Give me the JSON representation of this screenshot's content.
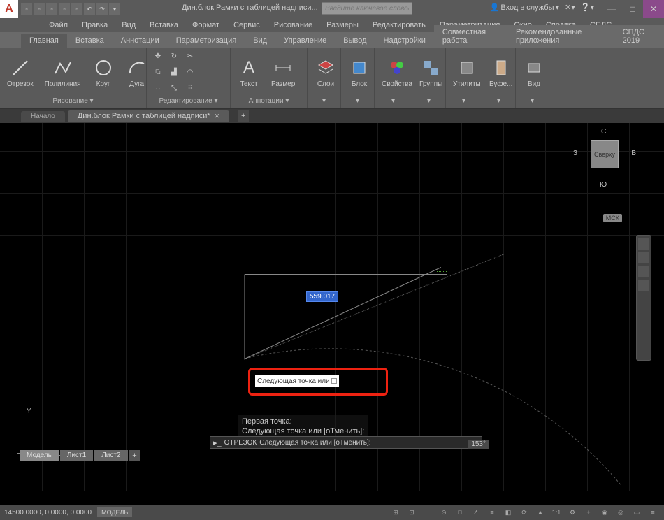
{
  "app": {
    "initial": "A",
    "doc_title": "Дин.блок Рамки с таблицей надписи...",
    "search_placeholder": "Введите ключевое слово/фразу",
    "signin": "Вход в службы"
  },
  "win": {
    "min": "—",
    "max": "□",
    "close": "✕"
  },
  "menubar": [
    "Файл",
    "Правка",
    "Вид",
    "Вставка",
    "Формат",
    "Сервис",
    "Рисование",
    "Размеры",
    "Редактировать",
    "Параметризация",
    "Окно",
    "Справка",
    "СПДС"
  ],
  "ribbon_tabs": [
    "Главная",
    "Вставка",
    "Аннотации",
    "Параметризация",
    "Вид",
    "Управление",
    "Вывод",
    "Надстройки",
    "Совместная работа",
    "Рекомендованные приложения",
    "СПДС 2019"
  ],
  "panels": {
    "draw": {
      "title": "Рисование ▾",
      "segment": "Отрезок",
      "polyline": "Полилиния",
      "circle": "Круг",
      "arc": "Дуга"
    },
    "edit": {
      "title": "Редактирование ▾"
    },
    "annot": {
      "title": "Аннотации ▾",
      "text": "Текст",
      "dim": "Размер"
    },
    "layers": {
      "title": "▾",
      "label": "Слои"
    },
    "block": {
      "title": "▾",
      "label": "Блок"
    },
    "props": {
      "title": "▾",
      "label": "Свойства"
    },
    "groups": {
      "title": "▾",
      "label": "Группы"
    },
    "utils": {
      "title": "▾",
      "label": "Утилиты"
    },
    "clip": {
      "title": "▾",
      "label": "Буфе..."
    },
    "view": {
      "title": "▾",
      "label": "Вид"
    }
  },
  "doc_tabs": {
    "start": "Начало",
    "doc": "Дин.блок Рамки с таблицей надписи*"
  },
  "viewcube": {
    "face": "Сверху",
    "n": "С",
    "s": "Ю",
    "e": "В",
    "w": "З",
    "badge": "МСК"
  },
  "axis": {
    "x": "X",
    "y": "Y"
  },
  "model_tabs": {
    "model": "Модель",
    "l1": "Лист1",
    "l2": "Лист2"
  },
  "dynamic": {
    "distance": "559.017",
    "prompt": "Следующая точка или"
  },
  "cmd": {
    "history1": "Первая точка:",
    "history2": "Следующая точка или [оТменить]:",
    "prefix": "ОТРЕЗОК",
    "prompt": "Следующая точка или [оТменить]:",
    "angle": "153°"
  },
  "status": {
    "coords": "14500.0000, 0.0000, 0.0000",
    "mode": "МОДЕЛЬ"
  }
}
